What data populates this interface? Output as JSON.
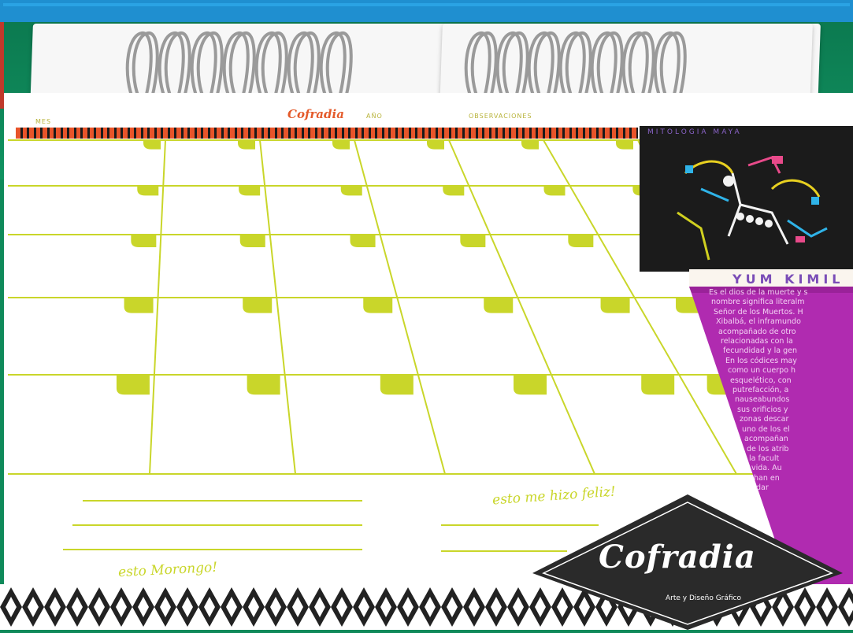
{
  "photo": {
    "subject": "spiral-bound desk calendar page",
    "colors": {
      "accent_lime": "#c9d62a",
      "magenta_panel": "#b02bb0",
      "panel_dark": "#1b1b1b",
      "purple_title": "#7a4db7",
      "brand_orange": "#e45a2a",
      "top_bar_blue": "#1f8fd0"
    }
  },
  "calendar": {
    "header": {
      "mes_label": "MES",
      "brand": "Cofradia",
      "ano_label": "AÑO",
      "observaciones_label": "OBSERVACIONES"
    },
    "grid": {
      "rows": 5,
      "columns": 7
    },
    "notes": {
      "left_handwriting": "esto Morongo!",
      "right_handwriting": "esto me hizo feliz!"
    }
  },
  "side_panel": {
    "series_title": "MITOLOGIA MAYA",
    "deity_name": "YUM KIMIL",
    "description_lines": [
      "Es el dios de la muerte y s",
      "nombre significa literalm",
      "Señor de los Muertos. H",
      "Xibalbá, el inframundo",
      "acompañado de otro",
      "relacionadas con la",
      "fecundidad y la gen",
      "En los códices may",
      "como un cuerpo h",
      "esquelético, con",
      "putrefacción, a",
      "nauseabundos",
      "sus orificios y",
      "zonas descar",
      "uno de los el",
      "acompañan",
      "de los atrib",
      "la facult",
      "vida. Au",
      "han en",
      "dar"
    ]
  },
  "logo": {
    "name": "Cofradia",
    "tagline": "Arte y Diseño Gráfico"
  }
}
